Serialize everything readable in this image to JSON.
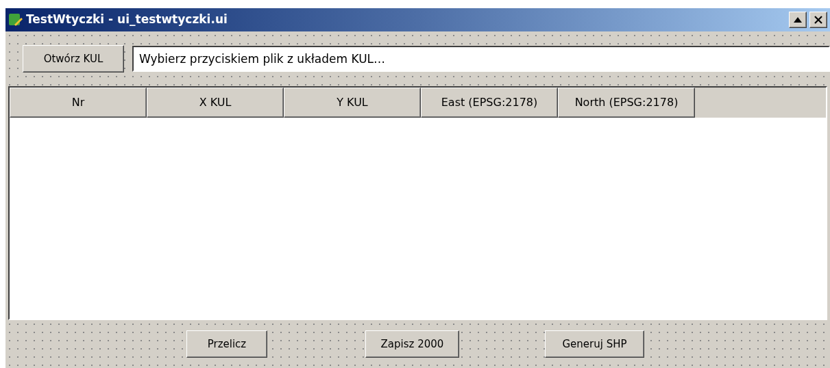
{
  "window": {
    "title": "TestWtyczki - ui_testwtyczki.ui"
  },
  "open_button": "Otwórz KUL",
  "file_field": {
    "value": "Wybierz przyciskiem plik z układem KUL…"
  },
  "table": {
    "columns": [
      "Nr",
      "X KUL",
      "Y KUL",
      "East (EPSG:2178)",
      "North (EPSG:2178)"
    ]
  },
  "buttons": [
    "Przelicz",
    "Zapisz 2000",
    "Generuj SHP"
  ]
}
